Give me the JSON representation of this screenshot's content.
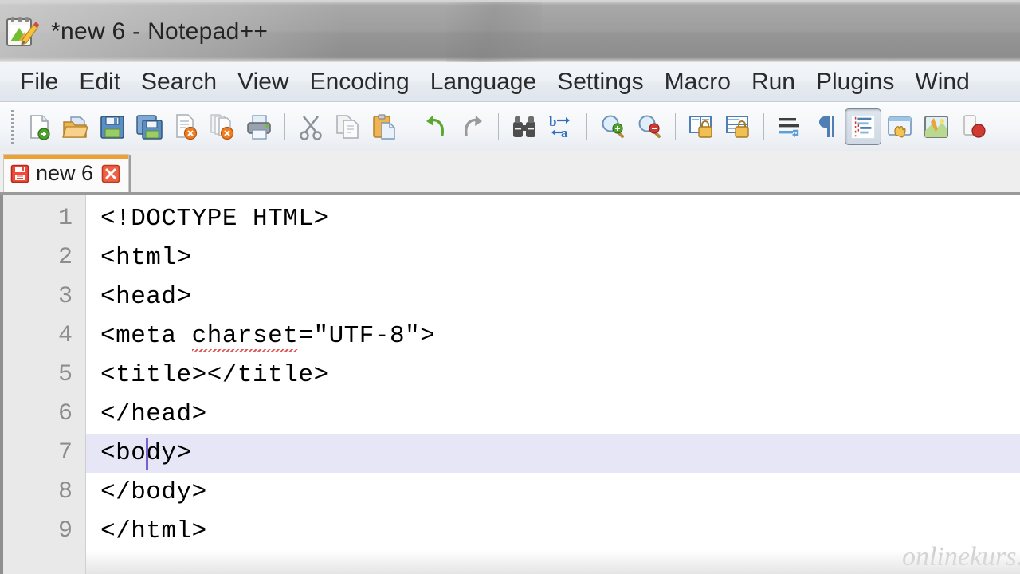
{
  "window": {
    "title": "*new 6 - Notepad++",
    "icon": "notepad-plus-plus-icon"
  },
  "menubar": {
    "items": [
      {
        "label": "File"
      },
      {
        "label": "Edit"
      },
      {
        "label": "Search"
      },
      {
        "label": "View"
      },
      {
        "label": "Encoding"
      },
      {
        "label": "Language"
      },
      {
        "label": "Settings"
      },
      {
        "label": "Macro"
      },
      {
        "label": "Run"
      },
      {
        "label": "Plugins"
      },
      {
        "label": "Wind"
      }
    ]
  },
  "toolbar": {
    "buttons": [
      {
        "name": "new-file",
        "icon": "new-document-icon",
        "pressed": false
      },
      {
        "name": "open-file",
        "icon": "open-folder-icon",
        "pressed": false
      },
      {
        "name": "save-file",
        "icon": "save-floppy-icon",
        "pressed": false
      },
      {
        "name": "save-all",
        "icon": "save-all-icon",
        "pressed": false
      },
      {
        "name": "close-file",
        "icon": "close-document-icon",
        "pressed": false
      },
      {
        "name": "close-all",
        "icon": "close-all-documents-icon",
        "pressed": false
      },
      {
        "name": "print",
        "icon": "printer-icon",
        "pressed": false
      },
      {
        "name": "separator-1",
        "icon": "separator",
        "pressed": false
      },
      {
        "name": "cut",
        "icon": "scissors-icon",
        "pressed": false
      },
      {
        "name": "copy",
        "icon": "copy-pages-icon",
        "pressed": false
      },
      {
        "name": "paste",
        "icon": "clipboard-paste-icon",
        "pressed": false
      },
      {
        "name": "separator-2",
        "icon": "separator",
        "pressed": false
      },
      {
        "name": "undo",
        "icon": "undo-arrow-icon",
        "pressed": false
      },
      {
        "name": "redo",
        "icon": "redo-arrow-icon",
        "pressed": false
      },
      {
        "name": "separator-3",
        "icon": "separator",
        "pressed": false
      },
      {
        "name": "find",
        "icon": "binoculars-icon",
        "pressed": false
      },
      {
        "name": "replace",
        "icon": "replace-ba-icon",
        "pressed": false
      },
      {
        "name": "separator-4",
        "icon": "separator",
        "pressed": false
      },
      {
        "name": "zoom-in",
        "icon": "magnifier-plus-icon",
        "pressed": false
      },
      {
        "name": "zoom-out",
        "icon": "magnifier-minus-icon",
        "pressed": false
      },
      {
        "name": "separator-5",
        "icon": "separator",
        "pressed": false
      },
      {
        "name": "sync-vertical-scroll",
        "icon": "sync-vertical-icon",
        "pressed": false
      },
      {
        "name": "sync-horizontal-scroll",
        "icon": "sync-horizontal-icon",
        "pressed": false
      },
      {
        "name": "separator-6",
        "icon": "separator",
        "pressed": false
      },
      {
        "name": "word-wrap",
        "icon": "word-wrap-icon",
        "pressed": false
      },
      {
        "name": "show-all-characters",
        "icon": "pilcrow-icon",
        "pressed": false
      },
      {
        "name": "show-indent-guide",
        "icon": "indent-guide-icon",
        "pressed": true
      },
      {
        "name": "user-defined-dialog",
        "icon": "udl-hand-icon",
        "pressed": false
      },
      {
        "name": "document-map",
        "icon": "document-map-icon",
        "pressed": false
      },
      {
        "name": "start-recording",
        "icon": "record-macro-icon",
        "pressed": false
      }
    ]
  },
  "tabs": [
    {
      "label": "new 6",
      "modified": true,
      "active": true,
      "icon": "unsaved-floppy-icon",
      "close_icon": "close-tab-icon"
    }
  ],
  "editor": {
    "lines": [
      {
        "number": "1",
        "text": "<!DOCTYPE HTML>",
        "current": false
      },
      {
        "number": "2",
        "text": "<html>",
        "current": false
      },
      {
        "number": "3",
        "text": "<head>",
        "current": false
      },
      {
        "number": "4",
        "text": "<meta charset=\"UTF-8\">",
        "current": false
      },
      {
        "number": "5",
        "text": "<title></title>",
        "current": false
      },
      {
        "number": "6",
        "text": "</head>",
        "current": false
      },
      {
        "number": "7",
        "text": "<body>",
        "current": true
      },
      {
        "number": "8",
        "text": "</body>",
        "current": false
      },
      {
        "number": "9",
        "text": "</html>",
        "current": false
      }
    ],
    "line4_parts": {
      "before": "<meta ",
      "misspelled": "charset",
      "after": "=\"UTF-8\">"
    },
    "line7_parts": {
      "before": "<bo",
      "after": "dy>"
    },
    "caret_line": "7",
    "caret_column": "4",
    "colors": {
      "current_line_highlight": "#e6e6f7",
      "caret": "#7a5fd0",
      "spellcheck_underline": "#e05a5a",
      "gutter_background": "#e9e9e9",
      "gutter_text": "#8d8d8d",
      "text": "#000000",
      "tab_active_accent": "#f0a030"
    }
  },
  "watermark": {
    "text": "onlinekurs."
  }
}
